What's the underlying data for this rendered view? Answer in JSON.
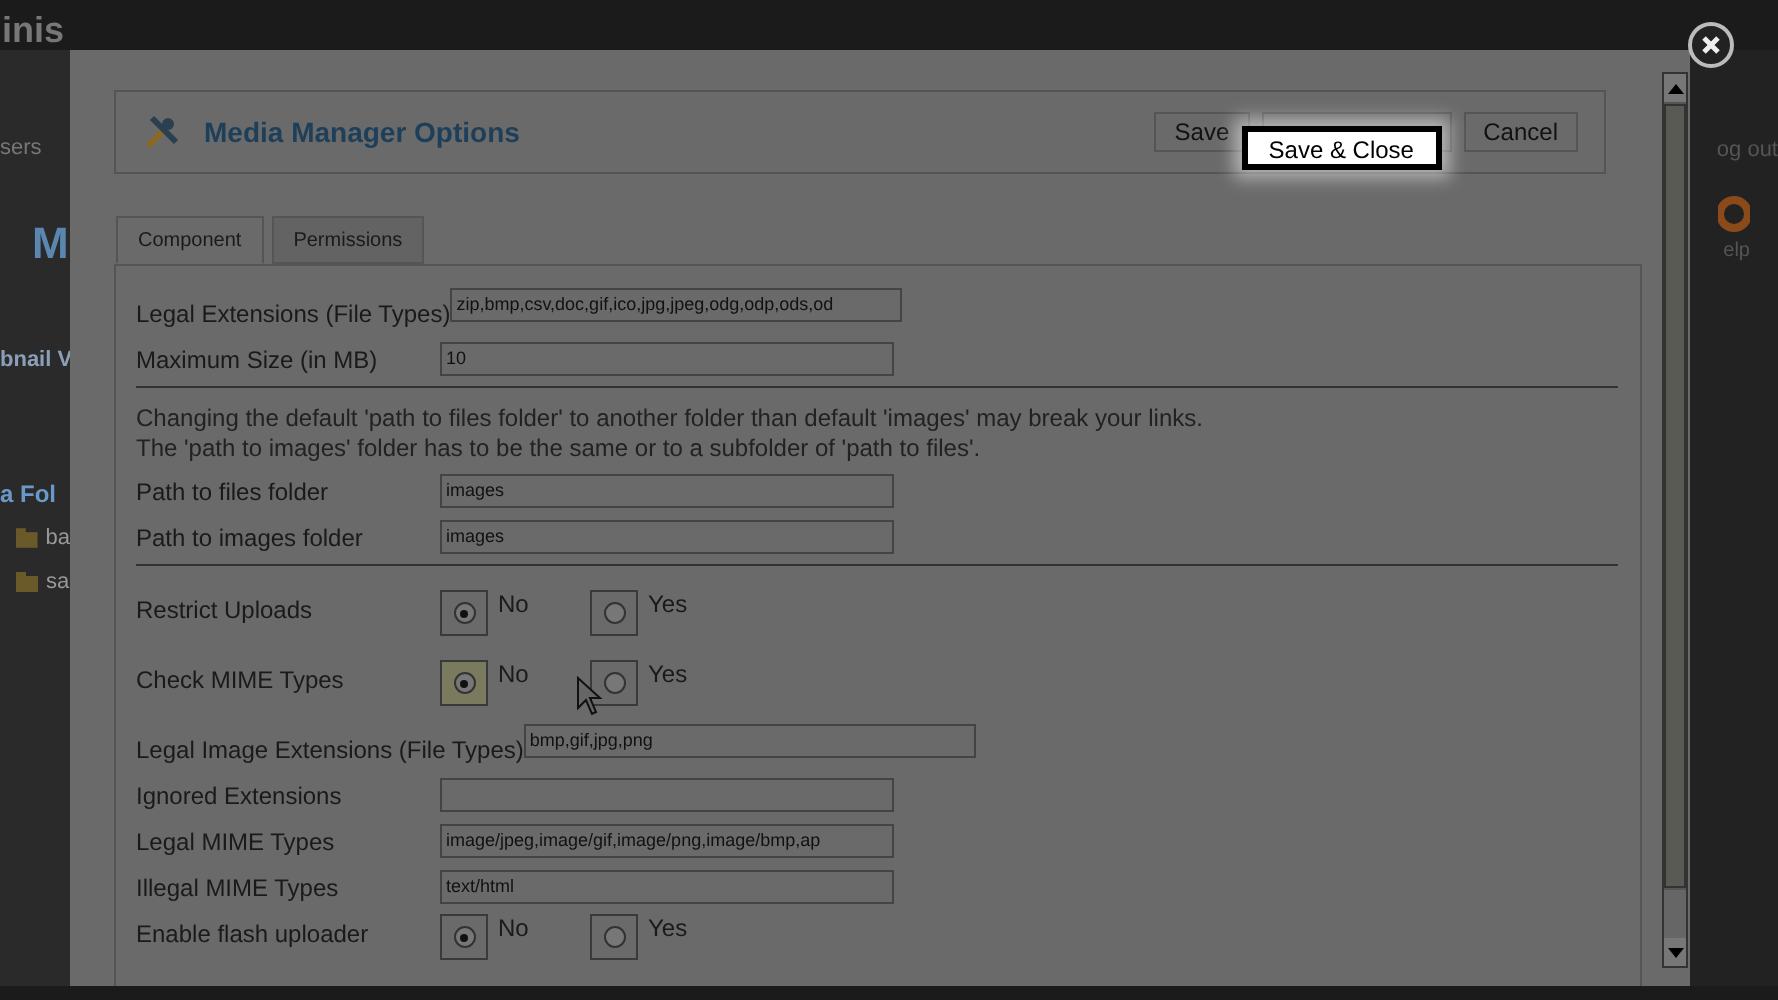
{
  "background": {
    "header_text": "inis",
    "menu_text": "sers",
    "heading_text": "M",
    "side_link": "bnail V",
    "side_heading": "a Fol",
    "folders": [
      "ba",
      "sa"
    ],
    "logout_text": "og out",
    "help_text": "elp"
  },
  "dialog": {
    "title": "Media Manager Options",
    "buttons": [
      {
        "label": "Save",
        "kind": "plain"
      },
      {
        "label": "Save & Close",
        "kind": "highlighted"
      },
      {
        "label": "Cancel",
        "kind": "plain"
      }
    ],
    "tabs": [
      {
        "label": "Component",
        "selected": true
      },
      {
        "label": "Permissions",
        "selected": false
      }
    ],
    "sections": [
      {
        "fields": [
          {
            "kind": "longtext",
            "label": "Legal Extensions (File Types)",
            "value": "zip,bmp,csv,doc,gif,ico,jpg,jpeg,odg,odp,ods,od"
          },
          {
            "kind": "text",
            "label": "Maximum Size (in MB)",
            "value": "10"
          }
        ]
      },
      {
        "note": [
          "Changing the default 'path to files folder' to another folder than default 'images' may break your links.",
          "The 'path to images' folder has to be the same or to a subfolder of 'path to files'."
        ],
        "fields": [
          {
            "kind": "text",
            "label": "Path to files folder",
            "value": "images"
          },
          {
            "kind": "text",
            "label": "Path to images folder",
            "value": "images"
          }
        ]
      },
      {
        "fields": [
          {
            "kind": "radio",
            "label": "Restrict Uploads",
            "options": [
              {
                "label": "No",
                "selected": true
              },
              {
                "label": "Yes",
                "selected": false
              }
            ]
          },
          {
            "kind": "radio",
            "label": "Check MIME Types",
            "options": [
              {
                "label": "No",
                "selected": true
              },
              {
                "label": "Yes",
                "selected": false
              }
            ],
            "hovered": true
          },
          {
            "kind": "longtext",
            "label": "Legal Image Extensions (File Types)",
            "value": "bmp,gif,jpg,png"
          },
          {
            "kind": "text",
            "label": "Ignored Extensions"
          },
          {
            "kind": "text",
            "label": "Legal MIME Types",
            "value": "image/jpeg,image/gif,image/png,image/bmp,ap"
          },
          {
            "kind": "text",
            "label": "Illegal MIME Types",
            "value": "text/html"
          },
          {
            "kind": "radio",
            "label": "Enable flash uploader",
            "options": [
              {
                "label": "No",
                "selected": true
              },
              {
                "label": "Yes",
                "selected": false
              }
            ]
          }
        ]
      }
    ]
  }
}
